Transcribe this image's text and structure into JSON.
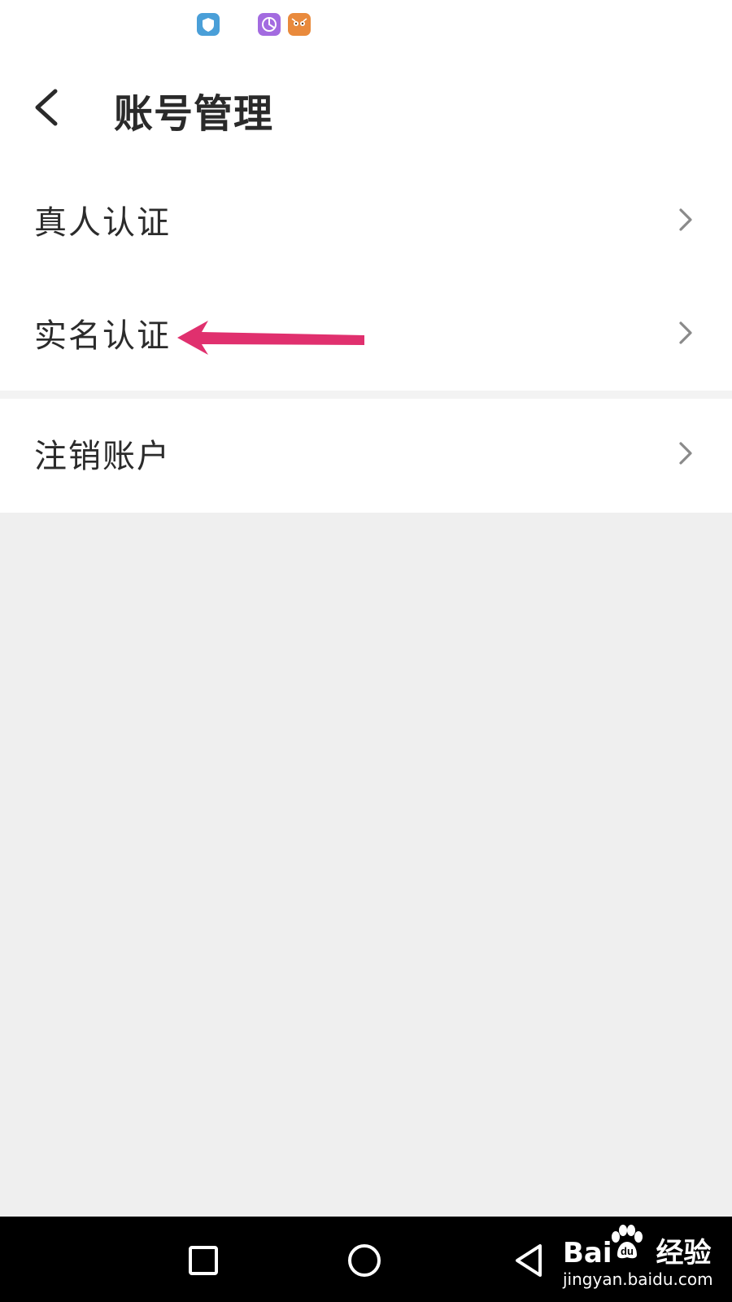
{
  "status_bar": {
    "icons": [
      "shield-icon",
      "browser-icon",
      "cat-app-icon"
    ]
  },
  "header": {
    "back_icon": "chevron-left-icon",
    "title": "账号管理"
  },
  "menu": {
    "items": [
      {
        "label": "真人认证",
        "icon": "chevron-right-icon"
      },
      {
        "label": "实名认证",
        "icon": "chevron-right-icon"
      },
      {
        "label": "注销账户",
        "icon": "chevron-right-icon"
      }
    ]
  },
  "annotation": {
    "arrow_color": "#e0306e",
    "points_to": "实名认证"
  },
  "nav_bar": {
    "buttons": [
      "recents-square-icon",
      "home-circle-icon",
      "back-triangle-icon"
    ]
  },
  "watermark": {
    "logo_prefix": "Bai",
    "logo_suffix": "经验",
    "url": "jingyan.baidu.com"
  },
  "colors": {
    "background": "#efefef",
    "card": "#ffffff",
    "nav_bar": "#000000",
    "text": "#2b2b2b",
    "chevron": "#8a8a8a"
  }
}
